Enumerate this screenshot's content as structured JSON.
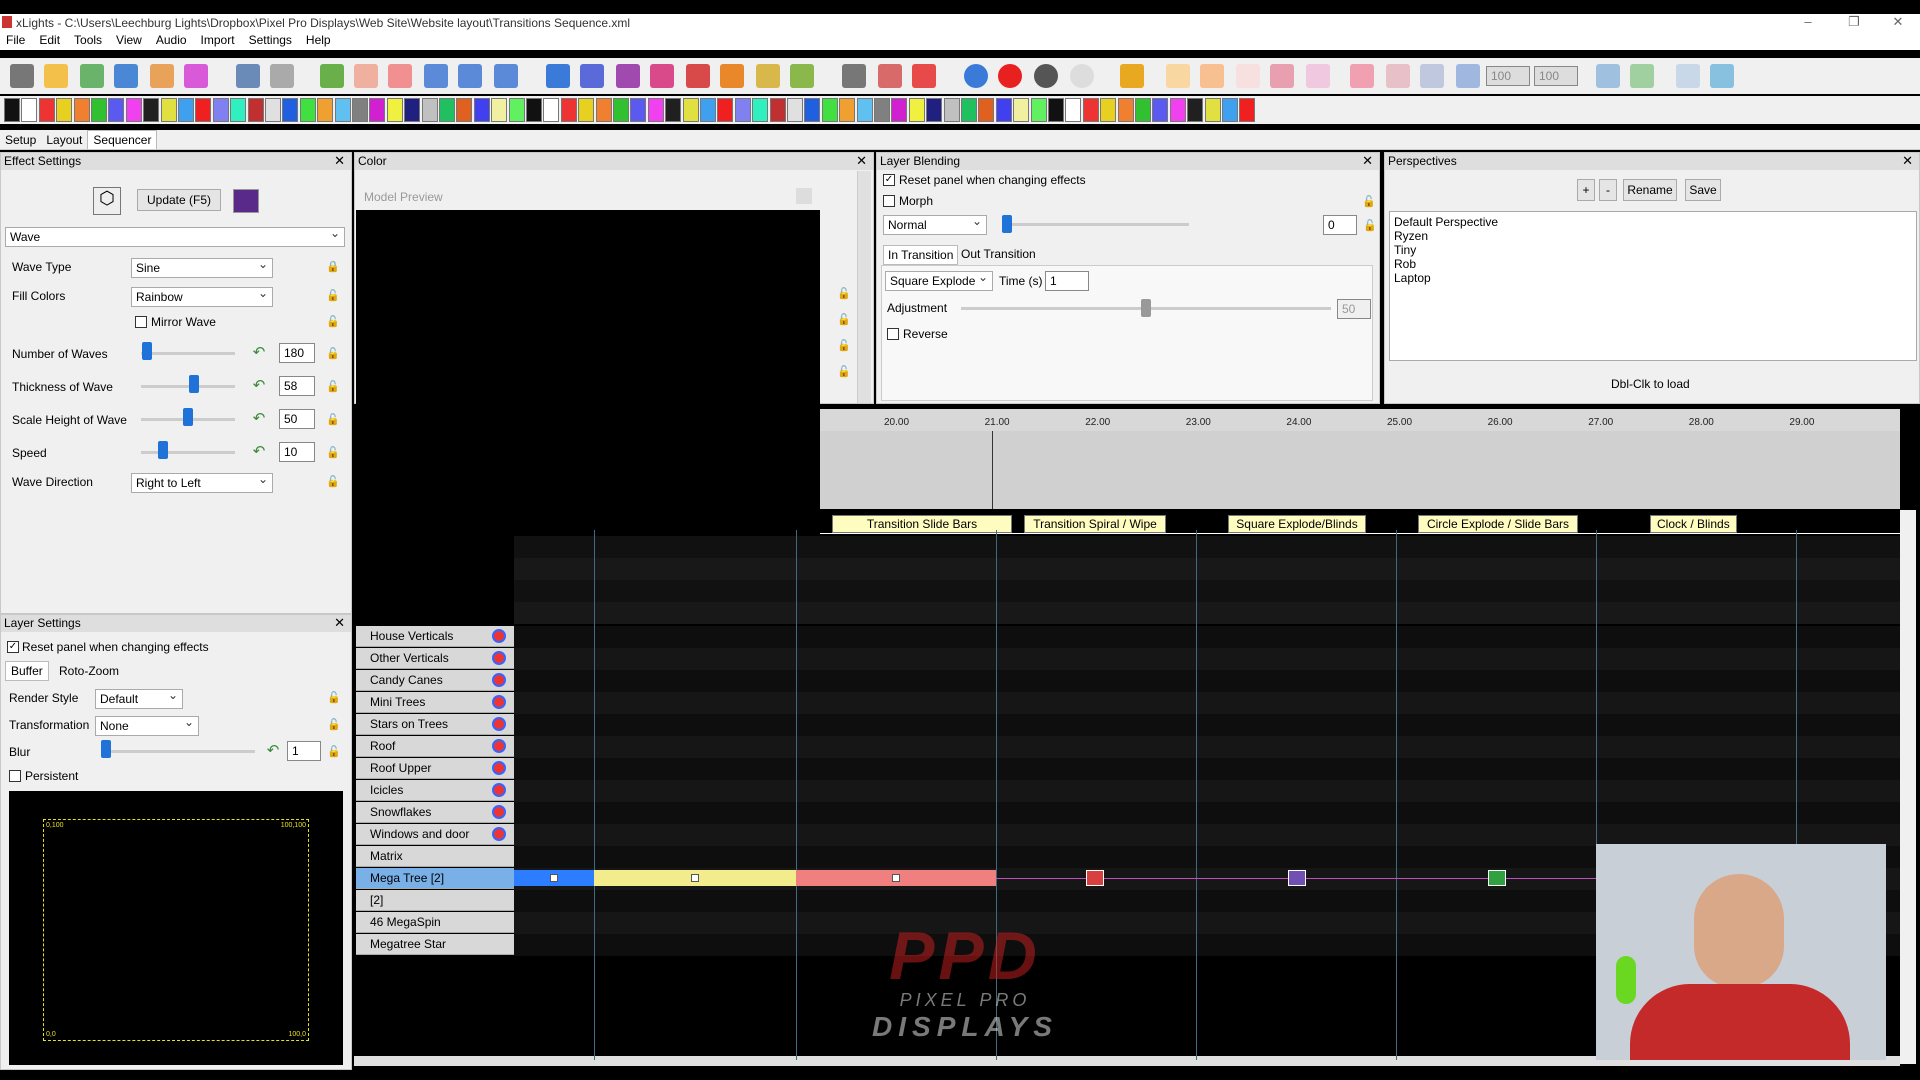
{
  "window": {
    "title": "xLights - C:\\Users\\Leechburg Lights\\Dropbox\\Pixel Pro Displays\\Web Site\\Website layout\\Transitions Sequence.xml",
    "minimize": "–",
    "restore": "❐",
    "close": "✕"
  },
  "menu": [
    "File",
    "Edit",
    "Tools",
    "View",
    "Audio",
    "Import",
    "Settings",
    "Help"
  ],
  "toolbar": {
    "zoom1": "100",
    "zoom2": "100"
  },
  "tabs": [
    "Setup",
    "Layout",
    "Sequencer"
  ],
  "effect_settings": {
    "title": "Effect Settings",
    "update_label": "Update (F5)",
    "effect": "Wave",
    "wave_type_label": "Wave Type",
    "wave_type": "Sine",
    "fill_colors_label": "Fill Colors",
    "fill_colors": "Rainbow",
    "mirror_label": "Mirror Wave",
    "num_waves_label": "Number of Waves",
    "num_waves": "180",
    "thickness_label": "Thickness of Wave",
    "thickness": "58",
    "scale_label": "Scale Height of Wave",
    "scale": "50",
    "speed_label": "Speed",
    "speed": "10",
    "direction_label": "Wave Direction",
    "direction": "Right to Left"
  },
  "color_panel": {
    "title": "Color"
  },
  "model_preview": {
    "title": "Model Preview"
  },
  "layer_blending": {
    "title": "Layer Blending",
    "reset_label": "Reset panel when changing effects",
    "morph_label": "Morph",
    "blend_mode": "Normal",
    "blend_value": "0",
    "tab_in": "In Transition",
    "tab_out": "Out Transition",
    "transition": "Square Explode",
    "time_label": "Time (s)",
    "time": "1",
    "adjustment_label": "Adjustment",
    "adjustment": "50",
    "reverse_label": "Reverse"
  },
  "perspectives": {
    "title": "Perspectives",
    "add": "+",
    "remove": "-",
    "rename": "Rename",
    "save": "Save",
    "items": [
      "Default Perspective",
      "Ryzen",
      "Tiny",
      "Rob",
      "Laptop"
    ],
    "hint": "Dbl-Clk to load"
  },
  "layer_settings": {
    "title": "Layer Settings",
    "reset_label": "Reset panel when changing effects",
    "tab_buffer": "Buffer",
    "tab_roto": "Roto-Zoom",
    "render_style_label": "Render Style",
    "render_style": "Default",
    "transformation_label": "Transformation",
    "transformation": "None",
    "blur_label": "Blur",
    "blur": "1",
    "persistent_label": "Persistent",
    "corner_tl": "0,100",
    "corner_tr": "100,100",
    "corner_bl": "0,0",
    "corner_br": "100,0"
  },
  "timeline": {
    "ticks": [
      "20.00",
      "21.00",
      "22.00",
      "23.00",
      "24.00",
      "25.00",
      "26.00",
      "27.00",
      "28.00",
      "29.00"
    ],
    "labels": [
      "Transition Slide Bars",
      "Transition Spiral / Wipe",
      "Square Explode/Blinds",
      "Circle Explode / Slide Bars",
      "Clock / Blinds"
    ]
  },
  "models": [
    "House Verticals",
    "Other Verticals",
    "Candy Canes",
    "Mini Trees",
    "Stars on Trees",
    "Roof",
    "Roof Upper",
    "Icicles",
    "Snowflakes",
    "Windows and door",
    "Matrix",
    "Mega Tree [2]",
    "[2]",
    "46 MegaSpin",
    "Megatree Star"
  ],
  "watermark": {
    "logo": "PPD",
    "line1": "PIXEL PRO",
    "line2": "DISPLAYS"
  },
  "colors": {
    "accent": "#1e72d8",
    "effect_blue": "#2c7dff",
    "effect_yellow": "#f2ec8c",
    "effect_salmon": "#f08080",
    "selected_row": "#7ab0e8"
  }
}
